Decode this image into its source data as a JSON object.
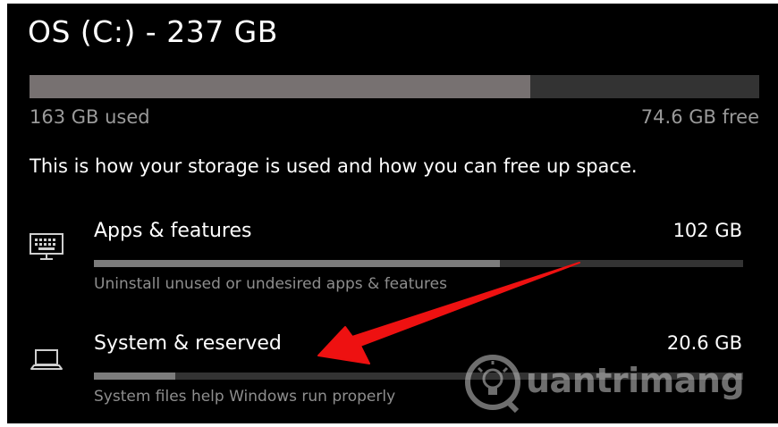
{
  "drive": {
    "title": "OS (C:) - 237 GB",
    "used_label": "163 GB used",
    "free_label": "74.6 GB free",
    "used_fraction": 0.686
  },
  "intro": "This is how your storage is used and how you can free up space.",
  "categories": [
    {
      "name": "Apps & features",
      "size": "102 GB",
      "description": "Uninstall unused or undesired apps & features",
      "icon": "keyboard-monitor-icon",
      "fraction": 0.625
    },
    {
      "name": "System & reserved",
      "size": "20.6 GB",
      "description": "System files help Windows run properly",
      "icon": "laptop-icon",
      "fraction": 0.126
    }
  ],
  "annotation": {
    "arrow_color": "#ee1111"
  },
  "watermark": {
    "text": "uantrimang"
  },
  "colors": {
    "background": "#000000",
    "bar_track": "#333333",
    "bar_fill": "#777171"
  }
}
